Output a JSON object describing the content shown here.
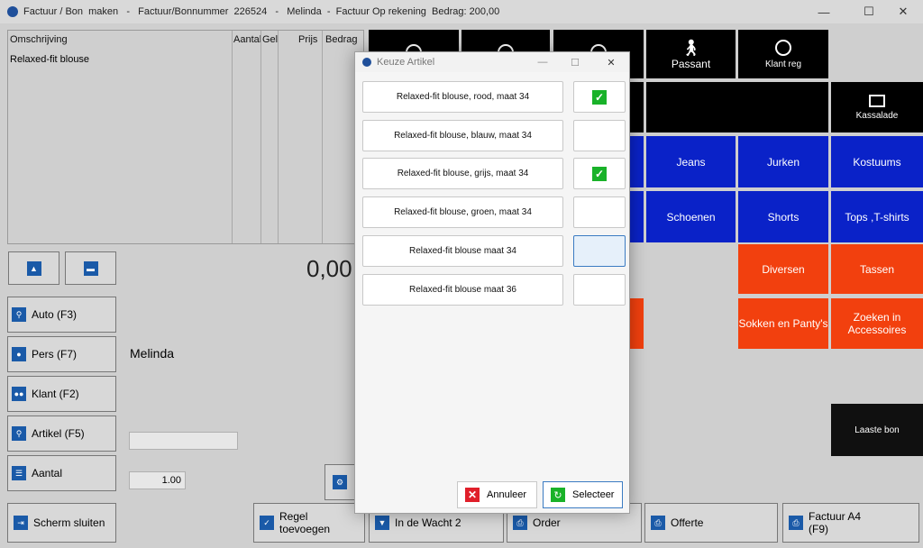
{
  "window": {
    "title": "Factuur / Bon  maken   -   Factuur/Bonnummer  226524   -   Melinda  -  Factuur Op rekening  Bedrag: 200,00",
    "min": "—",
    "max": "☐",
    "close": "✕"
  },
  "table": {
    "headers": [
      "Omschrijving",
      "Aantal",
      "Gel",
      "Prijs",
      "Bedrag"
    ],
    "rows": [
      {
        "omschrijving": "Relaxed-fit blouse"
      }
    ]
  },
  "amount": "0,00",
  "left_buttons": {
    "auto": "Auto (F3)",
    "pers": "Pers (F7)",
    "klant": "Klant (F2)",
    "artikel": "Artikel (F5)",
    "aantal": "Aantal"
  },
  "customer_name": "Melinda",
  "aantal_value": "1.00",
  "tiles": {
    "passant": "Passant",
    "klant_reg": "Klant reg",
    "kassalade": "Kassalade",
    "jeans": "Jeans",
    "jurken": "Jurken",
    "kostuums": "Kostuums",
    "schoenen": "Schoenen",
    "shorts": "Shorts",
    "tops": "Tops ,T-shirts",
    "diversen": "Diversen",
    "tassen": "Tassen",
    "sokken": "Sokken en Panty's",
    "zoeken": "Zoeken in Accessoires",
    "laaste_bon": "Laaste bon"
  },
  "bottom": {
    "scherm_sluiten": "Scherm sluiten",
    "regel_toevoegen": "Regel toevoegen",
    "in_de_wacht": "In de Wacht 2",
    "order": "Order",
    "offerte": "Offerte",
    "factuur_a4": "Factuur A4 (F9)"
  },
  "dialog": {
    "title": "Keuze Artikel",
    "options": [
      {
        "label": "Relaxed-fit blouse, rood, maat 34",
        "checked": true
      },
      {
        "label": "Relaxed-fit blouse, blauw, maat 34",
        "checked": false
      },
      {
        "label": "Relaxed-fit blouse, grijs, maat 34",
        "checked": true
      },
      {
        "label": "Relaxed-fit blouse, groen, maat 34",
        "checked": false
      },
      {
        "label": "Relaxed-fit blouse maat 34",
        "checked": false
      },
      {
        "label": "Relaxed-fit blouse maat 36",
        "checked": false
      }
    ],
    "cancel": "Annuleer",
    "select": "Selecteer"
  },
  "colors": {
    "tile_black": "#000000",
    "tile_blue": "#0a22c8",
    "tile_orange": "#f2400e",
    "check_green": "#19b229",
    "cancel_red": "#e01f2a"
  }
}
